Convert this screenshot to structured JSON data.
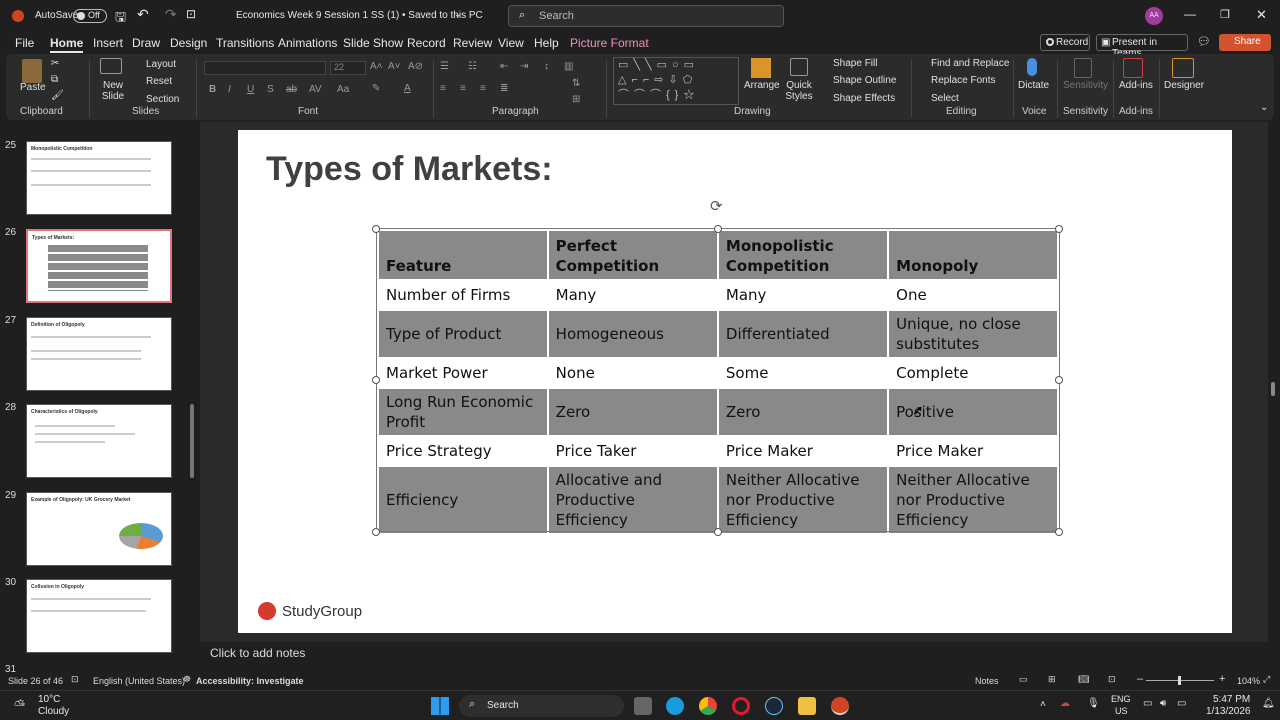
{
  "titlebar": {
    "autosave": "AutoSave",
    "toggle": "Off",
    "doc_title": "Economics Week 9 Session 1 SS (1) • Saved to this PC",
    "search": "Search",
    "avatar": "AA"
  },
  "tabs": [
    "File",
    "Home",
    "Insert",
    "Draw",
    "Design",
    "Transitions",
    "Animations",
    "Slide Show",
    "Record",
    "Review",
    "View",
    "Help",
    "Picture Format"
  ],
  "right_buttons": {
    "record": "Record",
    "present": "Present in Teams",
    "share": "Share"
  },
  "ribbon": {
    "paste": "Paste",
    "new_slide": "New Slide",
    "layout": "Layout",
    "reset": "Reset",
    "section": "Section",
    "font_size": "22",
    "arrange": "Arrange",
    "quick_styles": "Quick Styles",
    "shape_fill": "Shape Fill",
    "shape_outline": "Shape Outline",
    "shape_effects": "Shape Effects",
    "find_replace": "Find and Replace",
    "replace_fonts": "Replace Fonts",
    "select": "Select",
    "dictate": "Dictate",
    "sensitivity": "Sensitivity",
    "addins": "Add-ins",
    "designer": "Designer",
    "groups": {
      "clipboard": "Clipboard",
      "slides": "Slides",
      "font": "Font",
      "paragraph": "Paragraph",
      "drawing": "Drawing",
      "editing": "Editing",
      "voice": "Voice",
      "sensitivity": "Sensitivity",
      "addins": "Add-ins"
    }
  },
  "thumbnails": [
    {
      "num": "25",
      "title": "Monopolistic Competition"
    },
    {
      "num": "26",
      "title": "Types of Markets:"
    },
    {
      "num": "27",
      "title": "Definition of Oligopoly"
    },
    {
      "num": "28",
      "title": "Characteristics of Oligopoly"
    },
    {
      "num": "29",
      "title": "Example of Oligopoly: UK Grocery Market"
    },
    {
      "num": "30",
      "title": "Collusion in Oligopoly"
    },
    {
      "num": "31",
      "title": ""
    }
  ],
  "slide": {
    "title": "Types of Markets:",
    "logo": "StudyGroup",
    "table": {
      "headers": [
        "Feature",
        "Perfect Competition",
        "Monopolistic Competition",
        "Monopoly"
      ],
      "rows": [
        [
          "Number of Firms",
          "Many",
          "Many",
          "One"
        ],
        [
          "Type of Product",
          "Homogeneous",
          "Differentiated",
          "Unique, no close substitutes"
        ],
        [
          "Market Power",
          "None",
          "Some",
          "Complete"
        ],
        [
          "Long Run Economic Profit",
          "Zero",
          "Zero",
          "Positive"
        ],
        [
          "Price Strategy",
          "Price Taker",
          "Price Maker",
          "Price Maker"
        ],
        [
          "Efficiency",
          "Allocative and Productive Efficiency",
          "Neither Allocative nor Productive Efficiency",
          "Neither Allocative nor Productive Efficiency"
        ]
      ]
    }
  },
  "notes_placeholder": "Click to add notes",
  "status": {
    "slide_count": "Slide 26 of 46",
    "language": "English (United States)",
    "accessibility": "Accessibility: Investigate",
    "notes": "Notes",
    "zoom": "104%"
  },
  "taskbar": {
    "temp": "10°C",
    "weather": "Cloudy",
    "search": "Search",
    "lang1": "ENG",
    "lang2": "US",
    "time": "5:47 PM",
    "date": "1/13/2026"
  }
}
